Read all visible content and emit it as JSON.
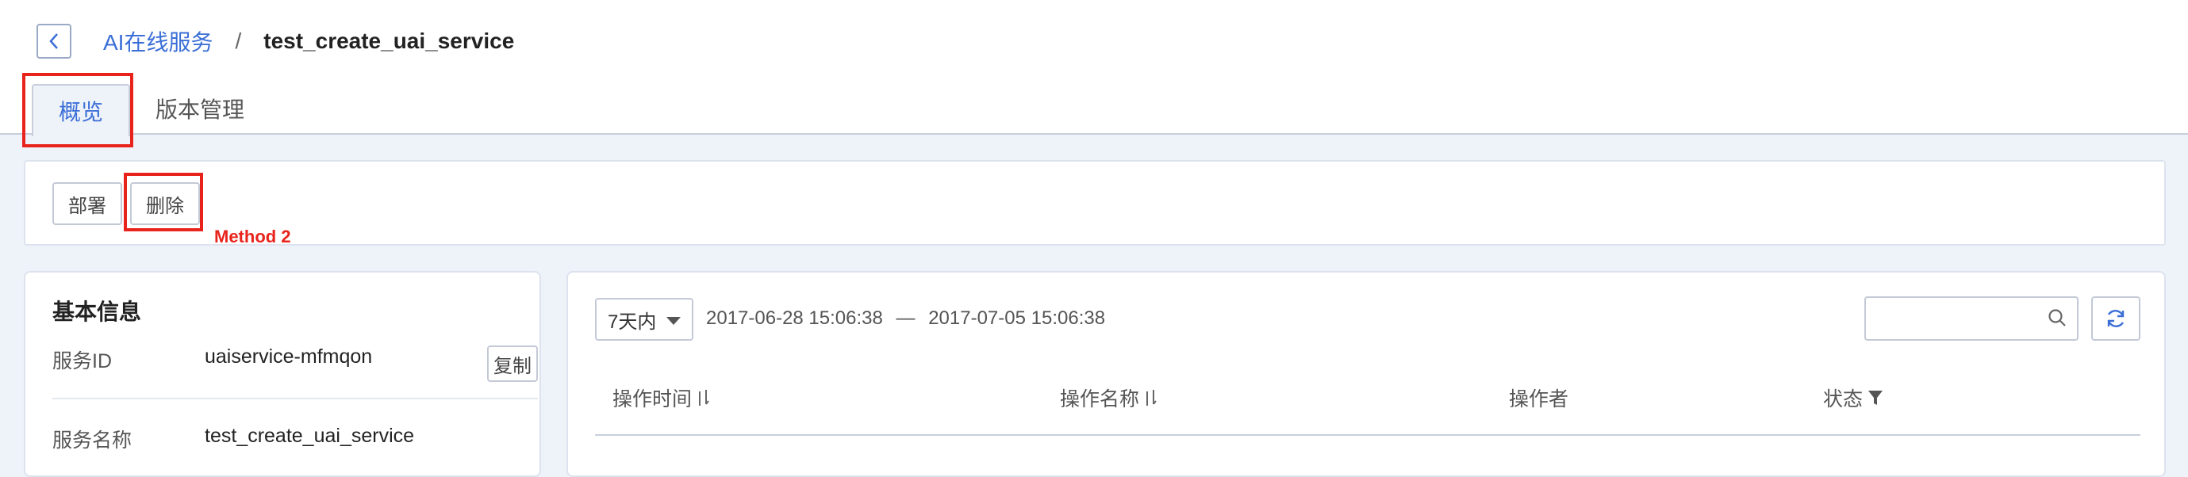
{
  "breadcrumb": {
    "parent": "AI在线服务",
    "separator": "/",
    "current": "test_create_uai_service"
  },
  "tabs": [
    {
      "label": "概览",
      "active": true
    },
    {
      "label": "版本管理",
      "active": false
    }
  ],
  "toolbar": {
    "deploy_label": "部署",
    "delete_label": "删除"
  },
  "annotation": {
    "method_label": "Method 2",
    "highlight_color": "#e8231c"
  },
  "info": {
    "title": "基本信息",
    "rows": [
      {
        "label": "服务ID",
        "value": "uaiservice-mfmqon",
        "action": "复制"
      },
      {
        "label": "服务名称",
        "value": "test_create_uai_service"
      }
    ]
  },
  "log": {
    "range_option": "7天内",
    "date_start": "2017-06-28 15:06:38",
    "date_sep": "—",
    "date_end": "2017-07-05 15:06:38",
    "search_placeholder": "",
    "columns": [
      {
        "label": "操作时间",
        "icon": "sort-icon"
      },
      {
        "label": "操作名称",
        "icon": "sort-icon"
      },
      {
        "label": "操作者"
      },
      {
        "label": "状态",
        "icon": "filter-icon"
      }
    ]
  },
  "colors": {
    "accent": "#3b6fd7",
    "page_bg": "#eef2f9"
  }
}
